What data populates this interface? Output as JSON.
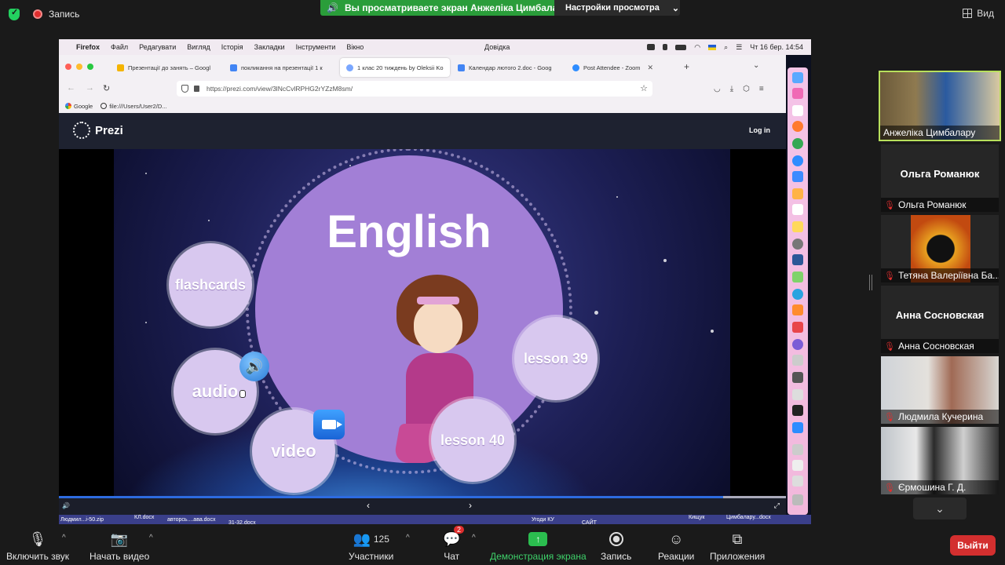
{
  "zoom_top": {
    "recording_label": "Запись",
    "banner": "Вы просматриваете экран Анжеліка Цимбалару",
    "view_settings": "Настройки просмотра",
    "view": "Вид"
  },
  "mac_menu": {
    "app": "Firefox",
    "items": [
      "Файл",
      "Редагувати",
      "Вигляд",
      "Історія",
      "Закладки",
      "Інструменти",
      "Вікно"
    ],
    "help": "Довідка",
    "clock": "Чт 16 бер.  14:54"
  },
  "tabs": [
    {
      "title": "Презентації до занять – Googl",
      "color": "#f4b400"
    },
    {
      "title": "покликання на презентації 1 к",
      "color": "#4285f4"
    },
    {
      "title": "1 клас 20 тиждень by Oleksii Ko",
      "color": "#7aa7ff"
    },
    {
      "title": "Календар лютого 2.doc - Goog",
      "color": "#4285f4"
    },
    {
      "title": "Post Attendee - Zoom",
      "color": "#2d8cff"
    }
  ],
  "browser": {
    "url": "https://prezi.com/view/3lNcCvlRPHG2rYZzM8sm/",
    "bookmarks": [
      "Google",
      "file:///Users/User2/D..."
    ]
  },
  "prezi": {
    "brand": "Prezi",
    "login": "Log in",
    "title": "English",
    "bubbles": {
      "flashcards": "flashcards",
      "audio": "audio",
      "video": "video",
      "lesson39": "lesson 39",
      "lesson40": "lesson 40"
    }
  },
  "desktop_files": [
    "Людмил...i-50.zip",
    "КЛ.docx",
    "авторсь....ава.docx",
    "31-32.docx",
    "Угоди КУ",
    "САЙТ",
    "Кищук",
    "Цимбалару...docx"
  ],
  "participants": [
    {
      "name": "Анжеліка Цимбалару",
      "video": true,
      "active": true
    },
    {
      "name": "Ольга Романюк",
      "big_name": "Ольга Романюк",
      "video": false
    },
    {
      "name": "Тетяна Валеріївна Ба...",
      "video": true,
      "muted": true
    },
    {
      "name": "Анна Сосновская",
      "big_name": "Анна Сосновская",
      "video": false
    },
    {
      "name": "Людмила Кучерина",
      "video": true,
      "muted": true
    },
    {
      "name": "Єрмошина Г. Д.",
      "video": true,
      "muted": true
    }
  ],
  "toolbar": {
    "audio": "Включить звук",
    "video": "Начать видео",
    "participants": "Участники",
    "participant_count": "125",
    "chat": "Чат",
    "chat_badge": "2",
    "share": "Демонстрация экрана",
    "record": "Запись",
    "reactions": "Реакции",
    "apps": "Приложения",
    "leave": "Выйти"
  },
  "colors": {
    "share_green": "#2a9d3a",
    "leave_red": "#d32f2f",
    "bubble_purple": "#a27fd6",
    "active_tile": "#b8e05c"
  }
}
